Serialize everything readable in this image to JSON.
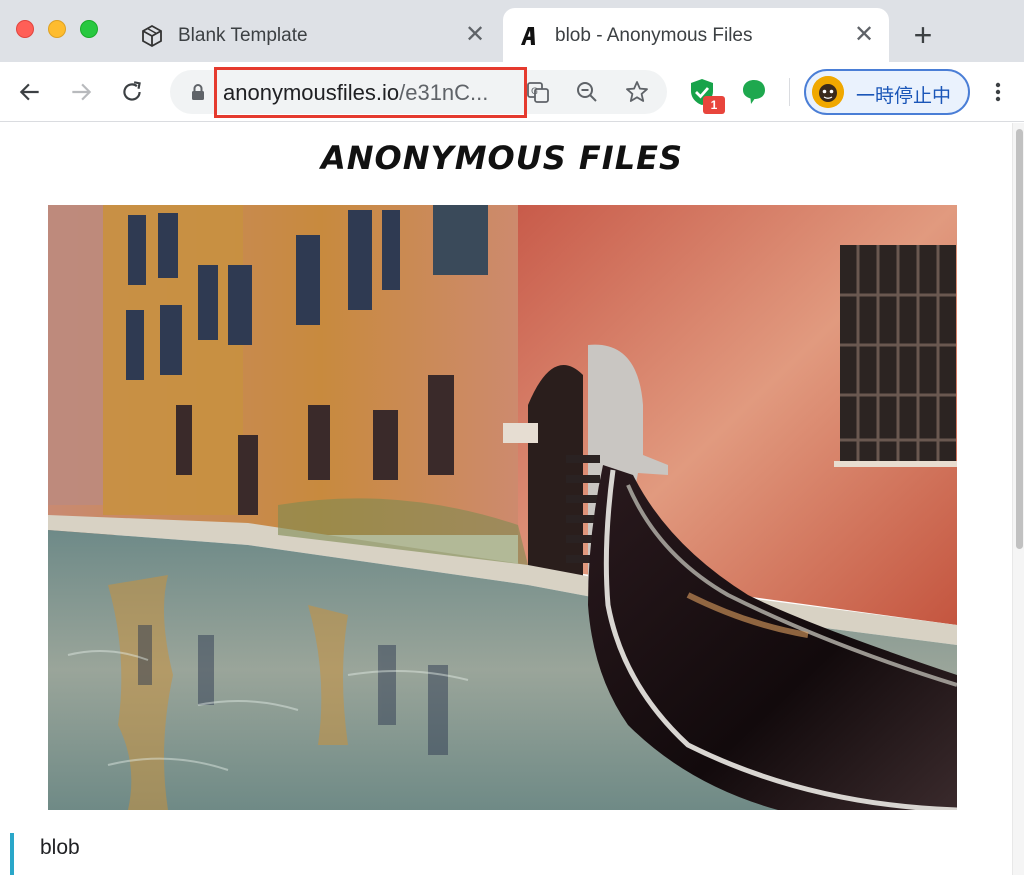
{
  "browser": {
    "tabs": [
      {
        "title": "Blank Template",
        "favicon": "cube-icon",
        "active": false
      },
      {
        "title": "blob - Anonymous Files",
        "favicon": "anonymous-a-icon",
        "active": true
      }
    ],
    "new_tab_label": "+",
    "close_glyph": "✕",
    "address": {
      "domain": "anonymousfiles.io",
      "path": "/e31nC..."
    },
    "extension_badge": "1",
    "profile_label": "一時停止中"
  },
  "page": {
    "title": "ANONYMOUS FILES",
    "file_name": "blob"
  },
  "colors": {
    "highlight_border": "#e53a2e",
    "accent_bar": "#2aa7c9",
    "profile_border": "#4a7ed6"
  }
}
